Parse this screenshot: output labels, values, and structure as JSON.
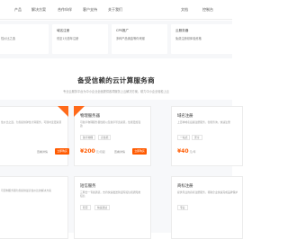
{
  "nav": {
    "items": [
      "产品",
      "解决方案",
      "合作伙伴",
      "客户支持",
      "关于我们"
    ],
    "right": [
      "文档",
      "控制台"
    ]
  },
  "promo": [
    {
      "line1": "",
      "line2": "性价比之选"
    },
    {
      "line1": "域名注册",
      "line2": "低至1元首年注册"
    },
    {
      "line1": "CPS推广",
      "line2": "多种产品佣金等你来赚"
    },
    {
      "line1": "云服务器",
      "line2": "免费注册领体验资格"
    }
  ],
  "section": {
    "title": "备受信赖的云计算服务商",
    "subtitle": "专业云服务平台为中小企业全面提供各项服务上云解决方案，助力中小企业轻松上云"
  },
  "cards": [
    {
      "title": "",
      "desc": "性价比之选，为您提供弹性计算服务，可随时变更资源",
      "tags": [
        "",
        ""
      ],
      "price": "",
      "unit": "",
      "detail": "查看详情",
      "button": "立即购买",
      "hot": "热"
    },
    {
      "title": "物理服务器",
      "desc": "可独享物理服务器性能以及独享带宽资源，性能更加强劲",
      "tags": [
        "独享物理",
        "高性能"
      ],
      "price": "¥200",
      "unit": "元/月起",
      "detail": "查看详情",
      "button": "立即购买",
      "hot": "热"
    },
    {
      "title": "域名注册",
      "desc": "上百种域名后缀注册服务，智能查询，快速注册",
      "tags": [
        "一站式",
        "安全"
      ],
      "price": "¥40",
      "unit": "元/年",
      "detail": "",
      "button": "",
      "hot": ""
    },
    {
      "title": "",
      "desc": "可定制服务器为您提供最高性价比的解决方案",
      "tags": [
        "",
        ""
      ],
      "price": "",
      "unit": "",
      "detail": "",
      "button": "",
      "hot": ""
    },
    {
      "title": "短信服务",
      "desc": "三网合一专属通道，支持快速发送验证码短信和通知类短信",
      "tags": [
        "稳定",
        "快速送达"
      ],
      "price": "",
      "unit": "",
      "detail": "",
      "button": "",
      "hot": ""
    },
    {
      "title": "商标注册",
      "desc": "提供专业的商标注册服务，帮助企业快速完成品牌保护",
      "tags": [
        "专业",
        ""
      ],
      "price": "",
      "unit": "",
      "detail": "",
      "button": "",
      "hot": ""
    }
  ]
}
